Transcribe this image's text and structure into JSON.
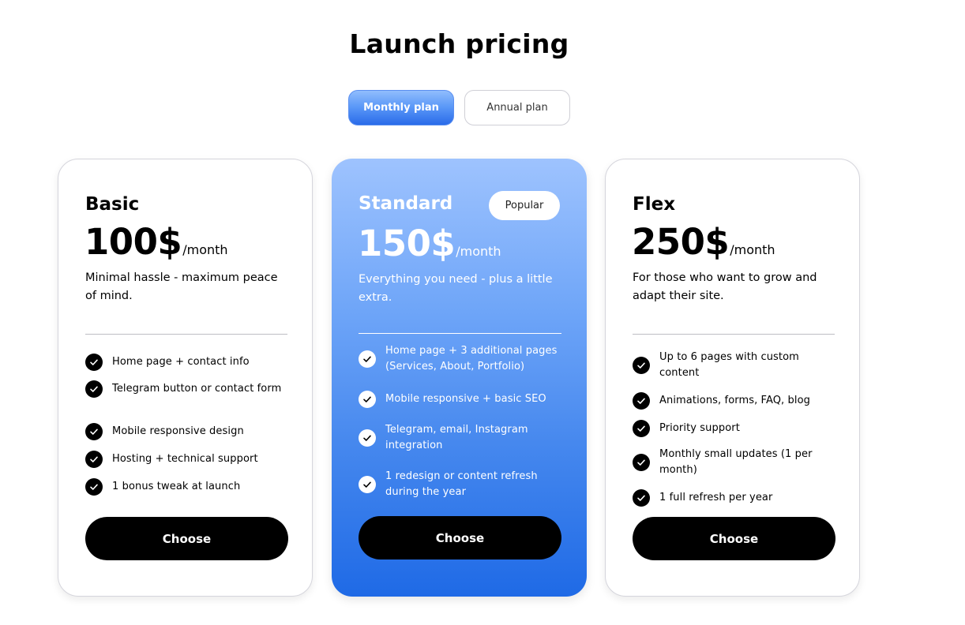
{
  "page_title": "Launch pricing",
  "toggle": {
    "monthly_label": "Monthly plan",
    "annual_label": "Annual plan",
    "selected": "monthly"
  },
  "colors": {
    "accent_gradient_top": "#9ec3fe",
    "accent_gradient_bottom": "#1f6ae6",
    "button_bg": "#000000",
    "card_border": "#d5d5dc"
  },
  "plans": [
    {
      "name": "Basic",
      "price": "100$",
      "period": "/month",
      "description": "Minimal hassle - maximum peace of mind.",
      "features": [
        "Home page + contact info",
        "Telegram button or contact form",
        "Mobile responsive design",
        "Hosting + technical support",
        "1 bonus tweak at launch"
      ],
      "button_label": "Choose"
    },
    {
      "name": "Standard",
      "badge": "Popular",
      "price": "150$",
      "period": "/month",
      "description": "Everything you need - plus a little extra.",
      "features": [
        "Home page + 3 additional pages (Services, About, Portfolio)",
        "Mobile responsive + basic SEO",
        "Telegram, email, Instagram integration",
        "1 redesign or content refresh during the year"
      ],
      "button_label": "Choose"
    },
    {
      "name": "Flex",
      "price": "250$",
      "period": "/month",
      "description": "For those who want to grow and adapt their site.",
      "features": [
        "Up to 6 pages with custom content",
        "Animations, forms, FAQ, blog",
        "Priority support",
        "Monthly small updates (1 per month)",
        "1 full refresh per year"
      ],
      "button_label": "Choose"
    }
  ]
}
